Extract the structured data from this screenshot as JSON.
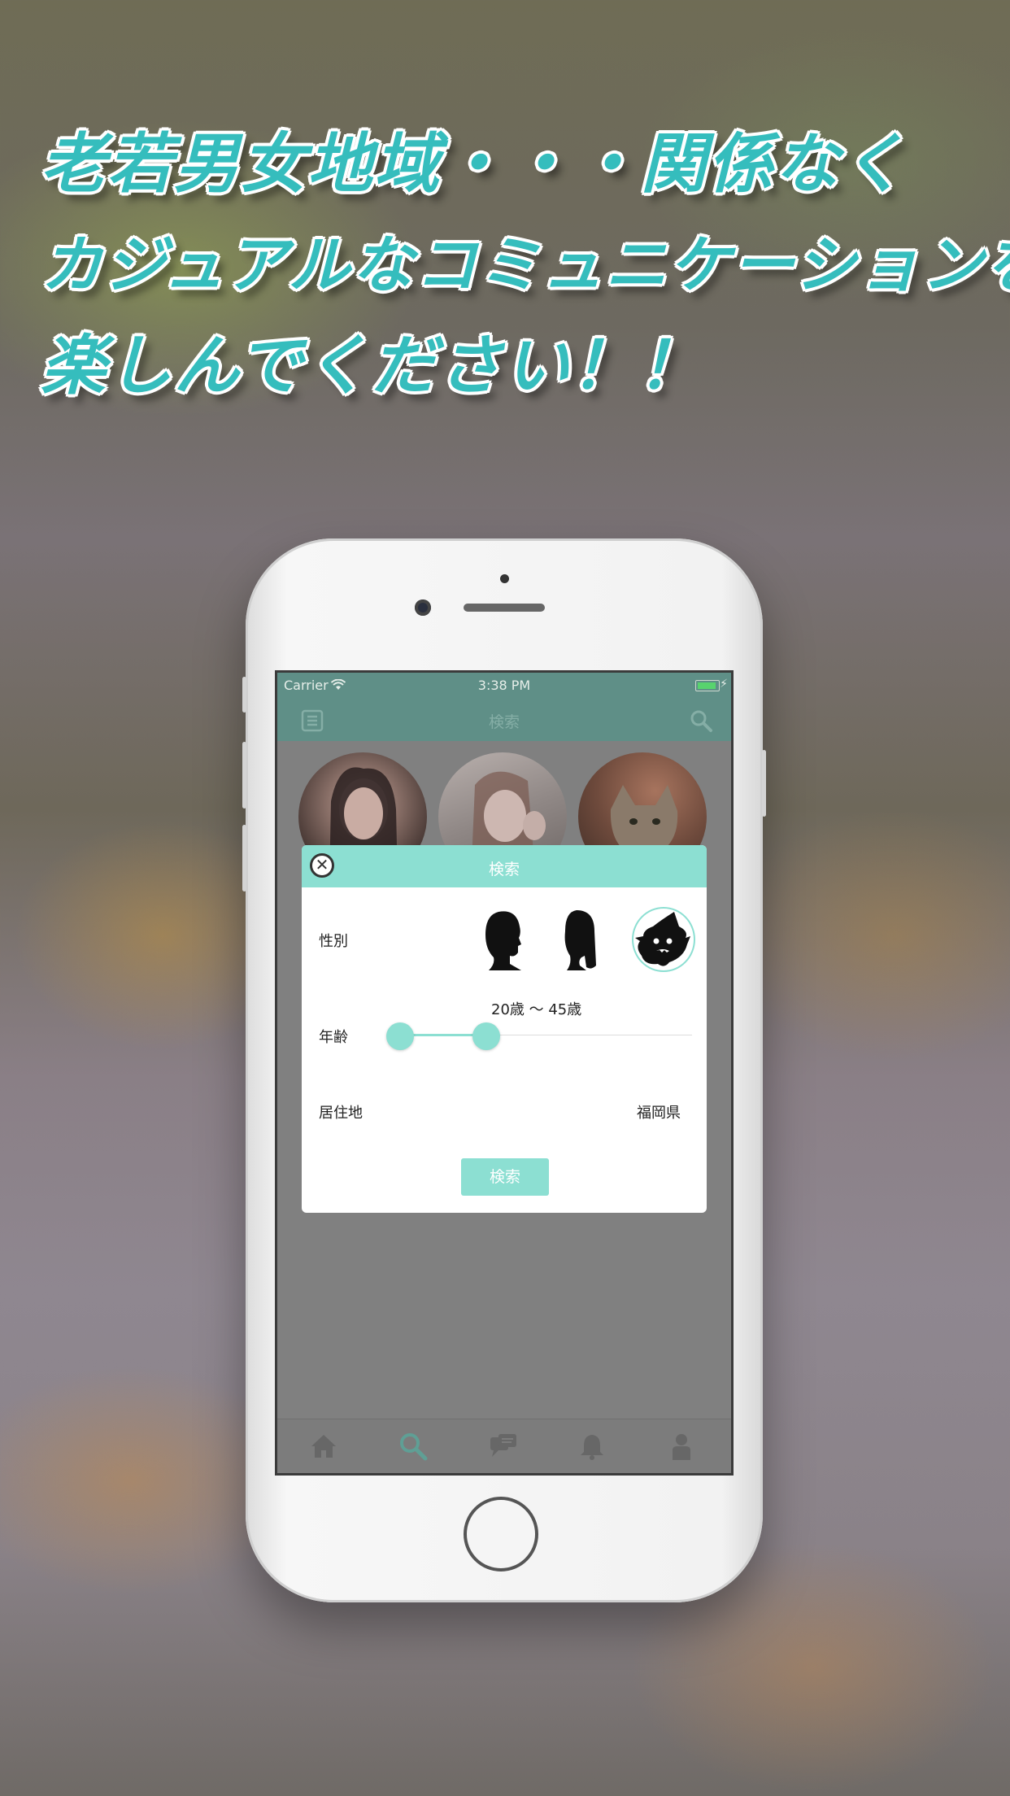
{
  "headline": {
    "line1": "老若男女地域・・・関係なく",
    "line2": "カジュアルなコミュニケーションを",
    "line3": "楽しんでください！！"
  },
  "status_bar": {
    "carrier": "Carrier",
    "time": "3:38 PM"
  },
  "nav": {
    "title": "検索",
    "left_icon": "list-icon",
    "right_icon": "search-icon"
  },
  "modal": {
    "title": "検索",
    "gender_label": "性別",
    "gender_options": [
      "male-silhouette-icon",
      "female-silhouette-icon",
      "ghost-witch-icon"
    ],
    "gender_selected": "ghost-witch-icon",
    "age_label": "年齢",
    "age_range": "20歳 〜 45歳",
    "location_label": "居住地",
    "location_value": "福岡県",
    "search_button": "検索"
  },
  "tabbar": {
    "items": [
      "home-icon",
      "search-icon",
      "chat-icon",
      "bell-icon",
      "person-icon"
    ],
    "active": "search-icon"
  },
  "colors": {
    "accent": "#8cdfd2",
    "headline": "#35bdbd",
    "navbar": "#5f8f87"
  }
}
